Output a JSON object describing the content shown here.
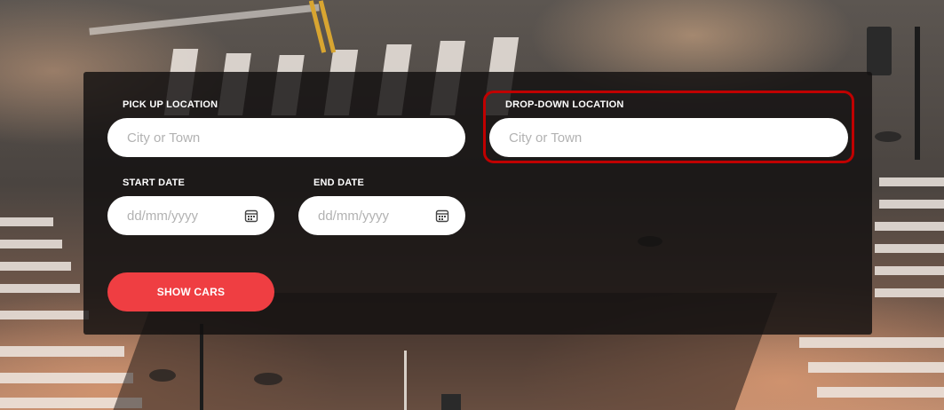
{
  "form": {
    "pickup": {
      "label": "PICK UP LOCATION",
      "placeholder": "City or Town"
    },
    "dropoff": {
      "label": "DROP-DOWN LOCATION",
      "placeholder": "City or Town"
    },
    "start_date": {
      "label": "START DATE",
      "placeholder": "dd/mm/yyyy",
      "icon": "calendar-icon"
    },
    "end_date": {
      "label": "END DATE",
      "placeholder": "dd/mm/yyyy",
      "icon": "calendar-icon"
    },
    "submit_label": "SHOW CARS"
  },
  "colors": {
    "accent": "#ef3e42",
    "highlight": "#c00000",
    "panel": "#121010"
  }
}
